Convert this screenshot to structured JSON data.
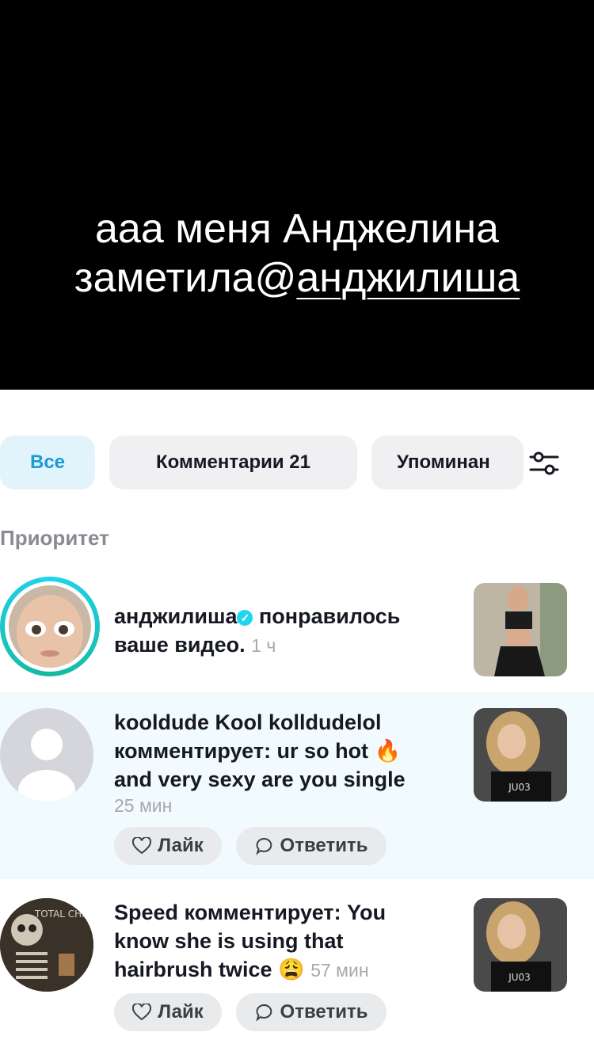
{
  "caption": {
    "line1": "ааа меня Анджелина",
    "line2_prefix": "заметила@",
    "line2_handle": "анджилиша"
  },
  "tabs": [
    {
      "label": "Все",
      "active": true
    },
    {
      "label": "Комментарии 21",
      "active": false
    },
    {
      "label": "Упоминан",
      "active": false
    }
  ],
  "section_title": "Приоритет",
  "notifications": [
    {
      "user": "анджилиша",
      "verified": true,
      "action": "понравилось",
      "action2": "ваше видео.",
      "time": "1 ч"
    },
    {
      "line1": "kooldude Kool kolldudelol",
      "line2": "комментирует: ur so hot",
      "emoji": "🔥",
      "line3": "and very sexy are you single",
      "time": "25 мин",
      "like_label": "Лайк",
      "reply_label": "Ответить"
    },
    {
      "line1": "Speed комментирует: You",
      "line2": "know she is using that",
      "line3": "hairbrush twice",
      "emoji": "😩",
      "time": "57 мин",
      "like_label": "Лайк",
      "reply_label": "Ответить",
      "avatar_text": "TOTAL CHILL"
    }
  ],
  "colors": {
    "accent": "#1b9ad6",
    "chip_active_bg": "#e1f3fb",
    "unread_bg": "#f1fafd",
    "verified": "#20d5ec"
  }
}
